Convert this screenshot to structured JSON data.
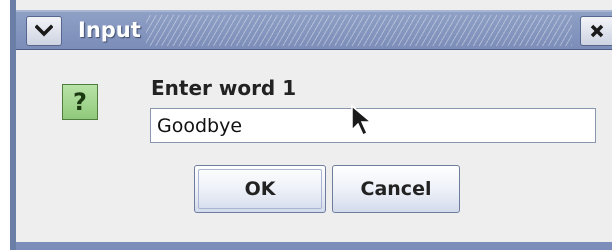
{
  "window": {
    "title": "Input",
    "menu_icon": "chevron-down-icon",
    "close_icon": "close-icon",
    "accent": "#7b8db8"
  },
  "dialog": {
    "icon": "question-icon",
    "icon_glyph": "?",
    "prompt": "Enter word 1",
    "input_value": "Goodbye"
  },
  "buttons": {
    "ok_label": "OK",
    "cancel_label": "Cancel"
  }
}
